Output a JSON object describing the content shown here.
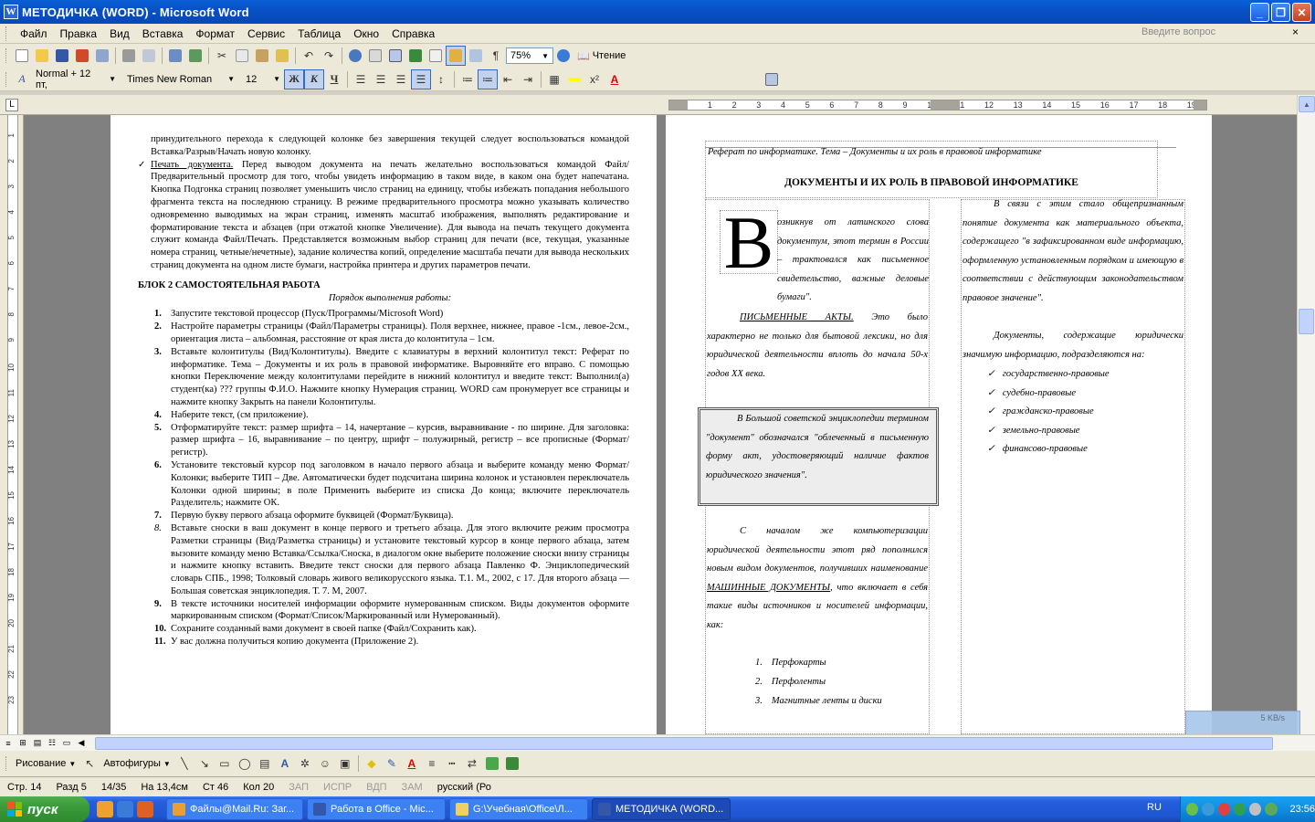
{
  "window": {
    "title": "МЕТОДИЧКА (WORD) - Microsoft Word",
    "min": "_",
    "max": "❐",
    "close": "✕"
  },
  "menu": {
    "items": [
      "Файл",
      "Правка",
      "Вид",
      "Вставка",
      "Формат",
      "Сервис",
      "Таблица",
      "Окно",
      "Справка"
    ],
    "ask_placeholder": "Введите вопрос",
    "close": "×"
  },
  "toolbar": {
    "zoom": "75%",
    "reading": "Чтение",
    "style": "Normal + 12 пт,",
    "font": "Times New Roman",
    "size": "12",
    "bold": "Ж",
    "italic": "К",
    "underline": "Ч",
    "colors": {
      "font_color": "#e00000",
      "highlight": "#ffff00"
    }
  },
  "ruler": {
    "numbers": [
      "11",
      "1",
      "2",
      "3",
      "4",
      "5",
      "6",
      "7",
      "8",
      "9",
      "10",
      "11",
      "12",
      "13",
      "14",
      "15",
      "16",
      "17",
      "18",
      "19"
    ],
    "corner": "L"
  },
  "vruler_numbers": [
    "1",
    "2",
    "3",
    "4",
    "5",
    "6",
    "7",
    "8",
    "9",
    "10",
    "11",
    "12",
    "13",
    "14",
    "15",
    "16",
    "17",
    "18",
    "19",
    "20",
    "21",
    "22",
    "23"
  ],
  "left_page": {
    "p1": "принудительного перехода к следующей колонке без завершения текущей следует воспользоваться командой Вставка/Разрыв/Начать новую колонку.",
    "print_heading": "Печать документа.",
    "print_text": " Перед выводом документа на печать желательно воспользоваться командой Файл/Предварительный просмотр для того, чтобы увидеть информацию в таком виде, в каком она будет напечатана. Кнопка Подгонка страниц позволяет уменьшить число страниц на единицу, чтобы избежать попадания небольшого фрагмента текста на последнюю страницу. В режиме предварительного просмотра можно указывать количество одновременно выводимых на экран страниц, изменять масштаб изображения, выполнять редактирование и форматирование текста и абзацев (при отжатой кнопке Увеличение). Для вывода на печать текущего документа служит команда Файл/Печать. Представляется возможным выбор страниц для печати (все, текущая, указанные номера страниц, четные/нечетные), задание количества копий, определение масштаба печати для вывода нескольких страниц документа на одном листе бумаги, настройка принтера и других параметров печати.",
    "block_title": "БЛОК 2 САМОСТОЯТЕЛЬНАЯ РАБОТА",
    "order": "Порядок выполнения работы:",
    "items": [
      {
        "n": "1.",
        "t": "Запустите текстовой процессор (Пуск/Программы/Microsoft Word)"
      },
      {
        "n": "2.",
        "t": "Настройте параметры страницы (Файл/Параметры страницы). Поля верхнее, нижнее, правое -1см., левое-2см., ориентация листа – альбомная, расстояние от края листа до колонтитула – 1см."
      },
      {
        "n": "3.",
        "t": "Вставьте колонтитулы (Вид/Колонтитулы). Введите с клавиатуры в верхний колонтитул текст: Реферат по информатике. Тема – Документы и их роль в правовой информатике. Выровняйте его вправо. С помощью кнопки Переключение между колонтитулами перейдите в нижний колонтитул и введите текст: Выполнил(а) студент(ка) ??? группы Ф.И.О. Нажмите кнопку Нумерация страниц. WORD сам пронумерует все страницы и нажмите кнопку Закрыть на панели Колонтитулы."
      },
      {
        "n": "4.",
        "t": "Наберите текст, (см приложение)."
      },
      {
        "n": "5.",
        "t": "Отформатируйте текст: размер шрифта – 14, начертание – курсив, выравнивание - по ширине. Для заголовка: размер шрифта – 16, выравнивание – по центру, шрифт – полужирный, регистр – все прописные (Формат/регистр)."
      },
      {
        "n": "6.",
        "t": "Установите текстовый курсор под заголовком в начало первого абзаца и выберите команду меню Формат/Колонки; выберите ТИП – Две. Автоматически будет подсчитана ширина колонок и установлен переключатель Колонки одной ширины; в поле Применить выберите из списка До конца; включите переключатель Разделитель; нажмите ОК."
      },
      {
        "n": "7.",
        "t": "Первую букву первого абзаца оформите буквицей (Формат/Буквица)."
      },
      {
        "n": "8.",
        "t": "Вставьте сноски в ваш документ в конце первого и третьего абзаца. Для этого включите режим просмотра Разметки страницы (Вид/Разметка страницы) и установите текстовый курсор в конце первого абзаца, затем вызовите команду меню Вставка/Ссылка/Сноска, в диалогом окне выберите положение сноски внизу страницы и нажмите кнопку вставить. Введите текст сноски для первого абзаца Павленко Ф. Энциклопедический словарь СПБ., 1998; Толковый словарь живого великорусского языка. Т.1. М., 2002, с 17. Для второго абзаца — Большая советская энциклопедия. Т. 7. М, 2007."
      },
      {
        "n": "9.",
        "t": "В тексте источники носителей информации оформите нумерованным списком. Виды документов оформите маркированным списком (Формат/Список/Маркированный или Нумерованный)."
      },
      {
        "n": "10.",
        "t": "Сохраните созданный вами документ в своей папке (Файл/Сохранить как)."
      },
      {
        "n": "11.",
        "t": "У вас должна получиться копию документа (Приложение 2)."
      }
    ]
  },
  "right_page": {
    "header": "Реферат по информатике. Тема – Документы и их роль в правовой информатике",
    "title": "ДОКУМЕНТЫ И ИХ РОЛЬ В ПРАВОВОЙ ИНФОРМАТИКЕ",
    "dropcap": "В",
    "col1_p1": "озникнув от латинского слова документум, этот термин в России – трактовался как письменное свидетельство, важные деловые бумаги\".",
    "col1_p2_u": "ПИСЬМЕННЫЕ АКТЫ.",
    "col1_p2": " Это было характерно не только для бытовой лексики, но для юридической деятельности вплоть до начала 50-х годов XX века.",
    "boxed": "В Большой советской энциклопедии термином \"документ\" обозначался \"облеченный в письменную форму акт, удостоверяющий наличие фактов юридического значения\".",
    "col1_p3a": "С началом же компьютеризации юридической деятельности этот ряд пополнился новым видом документов, получивших наименование ",
    "col1_p3u": "МАШИННЫЕ ДОКУМЕНТЫ",
    "col1_p3b": ", что включает в себя такие виды источников и носителей информации, как:",
    "num_list": [
      "Перфокарты",
      "Перфоленты",
      "Магнитные ленты и диски"
    ],
    "col2_p1": "В связи с этим стало общепризнанным понятие документа как материального объекта, содержащего \"в зафиксированном виде информацию, оформленную установленным порядком и имеющую в соответствии с действующим законодательством правовое значение\".",
    "col2_p2": "Документы, содержащие юридически значимую информацию, подразделяются на:",
    "check_list": [
      "государственно-правовые",
      "судебно-правовые",
      "гражданско-правовые",
      "земельно-правовые",
      "финансово-правовые"
    ]
  },
  "drawbar": {
    "draw": "Рисование",
    "autoshapes": "Автофигуры"
  },
  "status": {
    "page": "Стр. 14",
    "section": "Разд 5",
    "pages": "14/35",
    "at": "На 13,4см",
    "line": "Ст 46",
    "col": "Кол 20",
    "rec": "ЗАП",
    "trk": "ИСПР",
    "ext": "ВДП",
    "ovr": "ЗАМ",
    "lang": "русский (Ро"
  },
  "net": {
    "speed": "5 KB/s"
  },
  "taskbar": {
    "start": "пуск",
    "tasks": [
      "Файлы@Mail.Ru: Заг...",
      "Работа в Office - Міс...",
      "G:\\Учебная\\Office\\Л...",
      "МЕТОДИЧКА (WORD..."
    ],
    "lang": "RU",
    "clock": "23:56"
  }
}
